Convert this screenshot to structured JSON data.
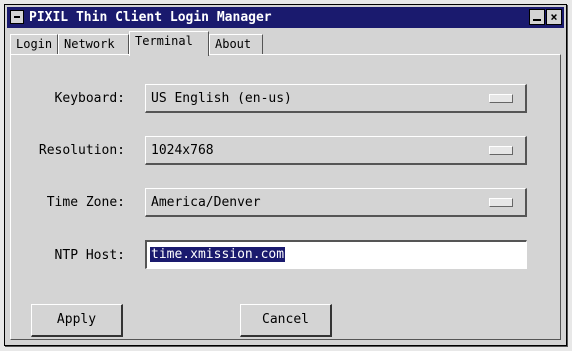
{
  "window": {
    "title": "PIXIL Thin Client Login Manager",
    "minimize_glyph": "",
    "close_glyph": "×"
  },
  "tabs": [
    {
      "label": "Login",
      "active": false
    },
    {
      "label": "Network",
      "active": false
    },
    {
      "label": "Terminal",
      "active": true
    },
    {
      "label": "About",
      "active": false
    }
  ],
  "form": {
    "keyboard": {
      "label": "Keyboard:",
      "value": "US English (en-us)"
    },
    "resolution": {
      "label": "Resolution:",
      "value": "1024x768"
    },
    "timezone": {
      "label": "Time Zone:",
      "value": "America/Denver"
    },
    "ntp": {
      "label": "NTP Host:",
      "value": "time.xmission.com"
    }
  },
  "buttons": {
    "apply": "Apply",
    "cancel": "Cancel"
  },
  "colors": {
    "titlebar": "#1a1a6e",
    "window_bg": "#d4d4d4",
    "selection": "#1a1a6e"
  }
}
